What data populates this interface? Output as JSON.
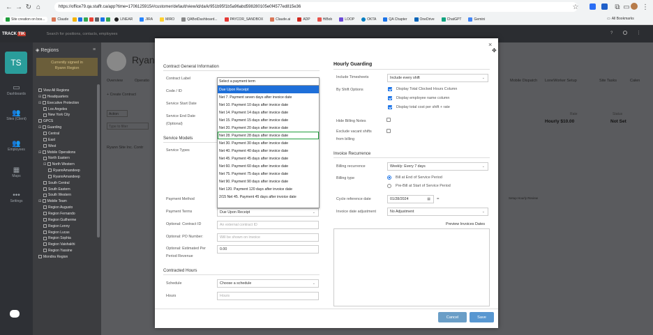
{
  "browser": {
    "tabs": [
      {
        "title": "Site creation on bos..."
      }
    ],
    "url": "https://office79.qa.staffr.ca/app?time=1706125915#/customer/default/view/id/da/k/951b95f1b5a96abd598280105e0f4577ed815e36",
    "bookmarks": [
      "Claude",
      "LINEAR",
      "JIRA",
      "MIRO",
      "QABotDashboard...",
      "PAYCOR_SANDBOX",
      "Claude.ai",
      "ADP",
      "HiBob",
      "LOOP",
      "OKTA",
      "QA Chapter",
      "OneDrive",
      "ChatGPT",
      "Gemini"
    ],
    "all_bookmarks": "All Bookmarks"
  },
  "app": {
    "logo": "TRACK",
    "logo_badge": "TIK",
    "search_placeholder": "Search for positions, contacts, employees",
    "help": "?",
    "nav": [
      {
        "label": "Dashboards"
      },
      {
        "label": "Sites (Client)"
      },
      {
        "label": "Employees"
      },
      {
        "label": "Maps"
      },
      {
        "label": "Settings"
      }
    ],
    "avatar": "TS",
    "sidebar": {
      "title": "Regions",
      "signed_in": "Currently signed in",
      "region": "Ryann Region",
      "tree": [
        "View All Regions",
        "Headquarters",
        "Executive Protection",
        "Los Angeles",
        "New York City",
        "GPCS",
        "Guarding",
        "Central",
        "East",
        "West",
        "Mobile Operations",
        "North Eastern",
        "North Western",
        "RyannAmandeep",
        "RyannAmandeep",
        "South Central",
        "South Eastern",
        "South Western",
        "Mobile Team",
        "Region Augusto",
        "Region Fernando",
        "Region Guilherme",
        "Region Lenny",
        "Region Lucas",
        "Region Sophia",
        "Region Vaishakhi",
        "Region Yassine",
        "Mondira Region"
      ]
    },
    "main": {
      "title": "Ryann",
      "tabs": [
        "Overview",
        "Operatio"
      ],
      "right_tabs": [
        "Mobile Dispatch",
        "LoneWorker Setup",
        "Site Tasks",
        "Calen"
      ],
      "create_contract": "Create Contract",
      "action": "Action",
      "type_filter": "Type to filter",
      "contract_row": "Ryann Site Inc. Contr",
      "rate_header": "Rate",
      "rate_value": "Hourly $10.00",
      "status_header": "Status",
      "status_value": "Not Set",
      "setup_hourly": "Setup Hourly Review"
    }
  },
  "modal": {
    "close": "×",
    "left": {
      "general_title": "Contract General Information",
      "contract_label": "Contract Label",
      "code": "Code / ID",
      "start_date": "Service Start Date",
      "end_date": "Service End Date",
      "optional": "(Optional)",
      "service_models": "Service Models",
      "service_types": "Service Types",
      "payment_method": "Payment Method",
      "payment_terms": "Payment Terms",
      "payment_terms_value": "Due Upon Receipt",
      "contract_id_label": "Optional: Contract ID",
      "contract_id_placeholder": "An external contract ID",
      "po_label": "Optional: PO Number:",
      "po_placeholder": "Will be shown on invoice",
      "est_label": "Optional: Estimated Per",
      "est_label2": "Period Revenue",
      "est_value": "0.00",
      "contracted_hours": "Contracted Hours",
      "schedule": "Schedule",
      "schedule_value": "Choose a schedule",
      "hours": "Hours",
      "hours_placeholder": "Hours"
    },
    "dropdown": {
      "items": [
        "Select a payment term",
        "Due Upon Receipt",
        "Net 7. Payment seven days after invoice date",
        "Net 10. Payment 10 days after invoice date",
        "Net 14. Payment 14 days after invoice date",
        "Net 15. Payment 15 days after invoice date",
        "Net 20. Payment 20 days after invoice date",
        "Net 28. Payment 28 days after invoice date",
        "Net 30. Payment 30 days after invoice date",
        "Net 40. Payment 40 days after invoice date",
        "Net 45. Payment 45 days after invoice date",
        "Net 60. Payment 60 days after invoice date",
        "Net 75. Payment 75 days after invoice date",
        "Net 90. Payment 90 days after invoice date",
        "Net 120. Payment 120 days after invoice date",
        "2/15 Net 45. Payment 45 days after invoice date"
      ],
      "selected_index": 1,
      "highlighted_index": 7
    },
    "right": {
      "hourly_title": "Hourly Guarding",
      "include_ts": "Include Timesheets",
      "include_ts_value": "Include every shift",
      "by_shift": "By Shift Options",
      "opt1": "Display Total Clocked Hours Column",
      "opt2": "Display employee name column",
      "opt3": "Display total cost per shift + rate",
      "hide_billing": "Hide Billing Notes",
      "exclude_vacant": "Exclude vacant shifts",
      "from_billing": "from billing",
      "invoice_recurrence": "Invoice Recurrence",
      "billing_recurrence": "Billing recurrence",
      "billing_recurrence_value": "Weekly: Every 7 days",
      "billing_type": "Billing type",
      "bill_end": "Bill at End of Service Period",
      "pre_bill": "Pre-Bill at Start of Service Period",
      "cycle_ref": "Cycle reference date",
      "cycle_value": "01/28/2024",
      "invoice_adj": "Invoice date adjustment",
      "invoice_adj_value": "No Adjustment",
      "preview": "Preview Invoices Dates"
    },
    "cancel": "Cancel",
    "save": "Save"
  }
}
